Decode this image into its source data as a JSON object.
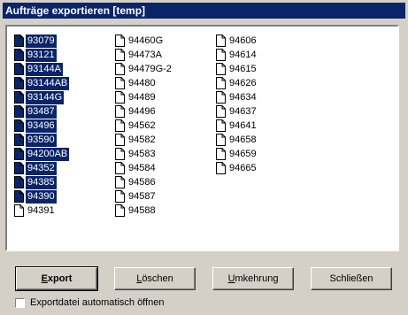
{
  "window": {
    "title": "Aufträge exportieren [temp]"
  },
  "list": {
    "columns": [
      [
        {
          "label": "93079",
          "selected": true
        },
        {
          "label": "93121",
          "selected": true
        },
        {
          "label": "93144A",
          "selected": true
        },
        {
          "label": "93144AB",
          "selected": true
        },
        {
          "label": "93144G",
          "selected": true
        },
        {
          "label": "93487",
          "selected": true
        },
        {
          "label": "93496",
          "selected": true
        },
        {
          "label": "93590",
          "selected": true
        },
        {
          "label": "94200AB",
          "selected": true
        },
        {
          "label": "94352",
          "selected": true
        },
        {
          "label": "94385",
          "selected": true
        },
        {
          "label": "94390",
          "selected": true
        },
        {
          "label": "94391",
          "selected": false
        }
      ],
      [
        {
          "label": "94460G",
          "selected": false
        },
        {
          "label": "94473A",
          "selected": false
        },
        {
          "label": "94479G-2",
          "selected": false
        },
        {
          "label": "94480",
          "selected": false
        },
        {
          "label": "94489",
          "selected": false
        },
        {
          "label": "94496",
          "selected": false
        },
        {
          "label": "94562",
          "selected": false
        },
        {
          "label": "94582",
          "selected": false
        },
        {
          "label": "94583",
          "selected": false
        },
        {
          "label": "94584",
          "selected": false
        },
        {
          "label": "94586",
          "selected": false
        },
        {
          "label": "94587",
          "selected": false
        },
        {
          "label": "94588",
          "selected": false
        }
      ],
      [
        {
          "label": "94606",
          "selected": false
        },
        {
          "label": "94614",
          "selected": false
        },
        {
          "label": "94615",
          "selected": false
        },
        {
          "label": "94626",
          "selected": false
        },
        {
          "label": "94634",
          "selected": false
        },
        {
          "label": "94637",
          "selected": false
        },
        {
          "label": "94641",
          "selected": false
        },
        {
          "label": "94658",
          "selected": false
        },
        {
          "label": "94659",
          "selected": false
        },
        {
          "label": "94665",
          "selected": false
        }
      ]
    ]
  },
  "buttons": {
    "export": "Export",
    "delete": "Löschen",
    "invert": "Umkehrung",
    "close": "Schließen"
  },
  "options": {
    "auto_open_label": "Exportdatei automatisch öffnen",
    "auto_open_checked": false
  },
  "colors": {
    "selection": "#0a246a",
    "title_bar": "#0a246a",
    "face": "#d4d0c8"
  },
  "icons": {
    "list_item": "document-icon"
  }
}
